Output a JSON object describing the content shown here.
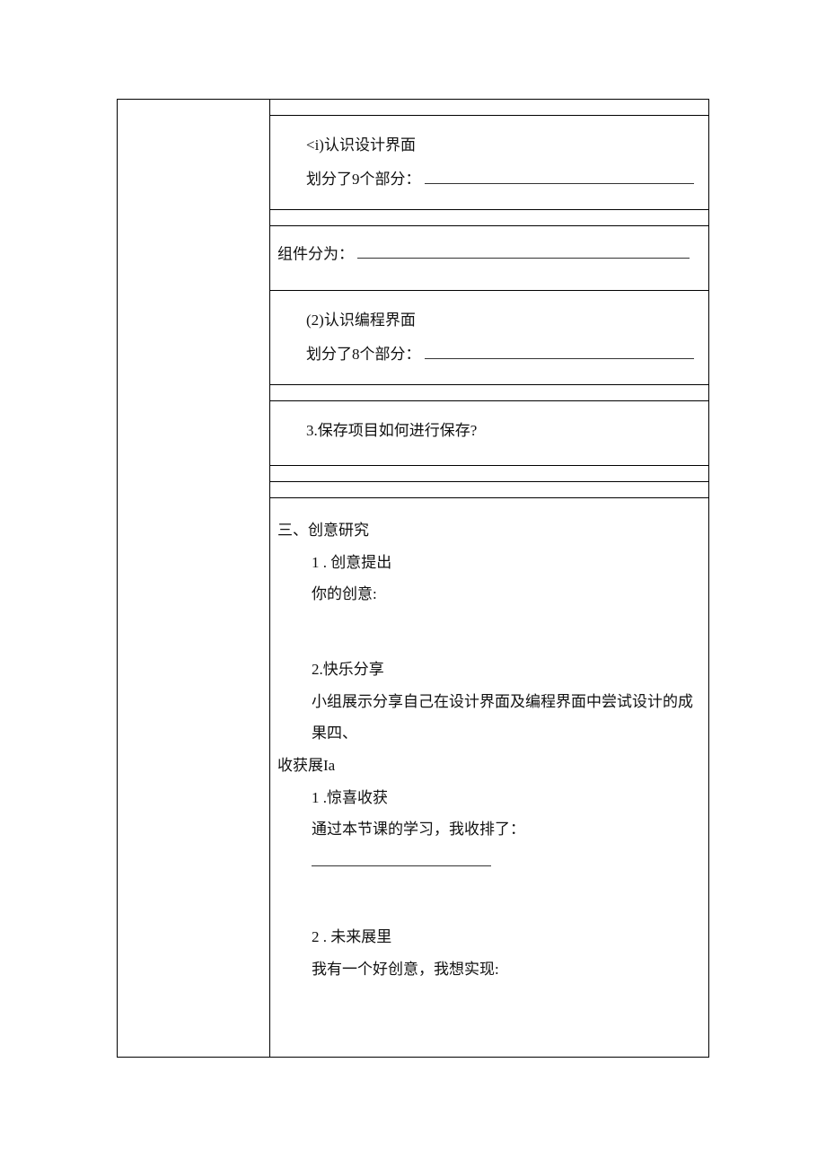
{
  "rows": {
    "r1_a": "<i)认识设计界面",
    "r1_b": "划分了9个部分：",
    "r2_a": "组件分为：",
    "r3_a": "(2)认识编程界面",
    "r3_b": "划分了8个部分：",
    "r4_a": "3.保存项目如何进行保存?"
  },
  "section3": {
    "heading": "三、创意研究",
    "p1_title": "1 . 创意提出",
    "p1_body": "你的创意:",
    "p2_title": "2.快乐分享",
    "p2_body": "小组展示分享自己在设计界面及编程界面中尝试设计的成果四、",
    "p2_body2": "收获展Ia",
    "p3_title": "1 .惊喜收获",
    "p3_body": "通过本节课的学习，我收排了：",
    "p4_title": "2 . 未来展里",
    "p4_body": "我有一个好创意，我想实现:"
  }
}
